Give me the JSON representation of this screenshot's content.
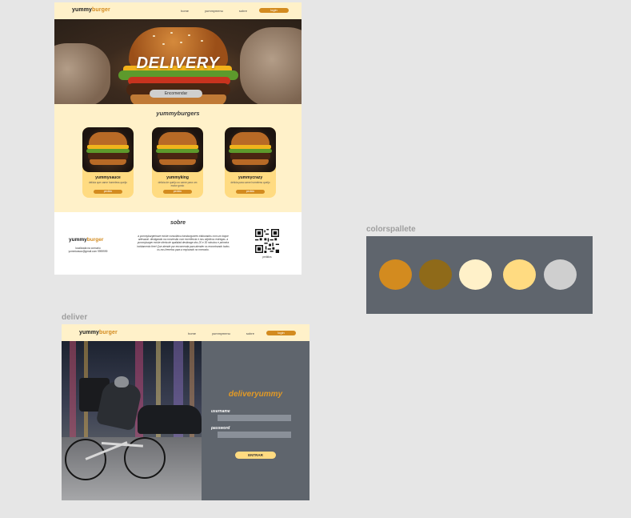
{
  "landing": {
    "nav": {
      "logo_a": "yummy",
      "logo_b": "burger",
      "links": [
        "home",
        "yummymenu",
        "sobre"
      ],
      "login": "login"
    },
    "hero": {
      "title": "DELIVERY",
      "button": "Encomendar"
    },
    "menu": {
      "title": "yummyburgers",
      "items": [
        {
          "name": "yummysauce",
          "desc": "delicia que carne homeless queijo",
          "button": "pedido"
        },
        {
          "name": "yummyking",
          "desc": "delicia de queijo ou carne para um maior gosto",
          "button": "pedido"
        },
        {
          "name": "yummycrazy",
          "desc": "delicia para carne homeless queijo",
          "button": "pedido"
        }
      ]
    },
    "sobre": {
      "title": "sobre",
      "logo_a": "yummy",
      "logo_b": "burger",
      "address": "localizada na comunio yummicasco@gmail.com 9999999",
      "text": "a yummyburgerhave existe consolidou hamburgueres elaborados com um toque artesanal. destigando na conversão com excelência e nos objetivos entregas. a yummyburger existe oferta de qualidad destinage dos 20 e 30 minutos e primeira incidamento free! Que atende por encomenda para atender os encontrando todos os nos frenetos para a explorado no mercado.",
      "qr_label": "pedidos"
    }
  },
  "palette": {
    "label": "colorspallete",
    "colors": [
      "#d38b1f",
      "#8f6a19",
      "#fff1c9",
      "#ffdb81",
      "#cfcfcf"
    ],
    "bg": "#5f656d"
  },
  "deliver": {
    "label": "deliver",
    "nav": {
      "logo_a": "yummy",
      "logo_b": "burger",
      "links": [
        "home",
        "yummymenu",
        "sobre"
      ],
      "login": "login"
    },
    "title": "deliveryummy",
    "username_label": "username",
    "password_label": "password",
    "submit": "ENTRAR"
  }
}
